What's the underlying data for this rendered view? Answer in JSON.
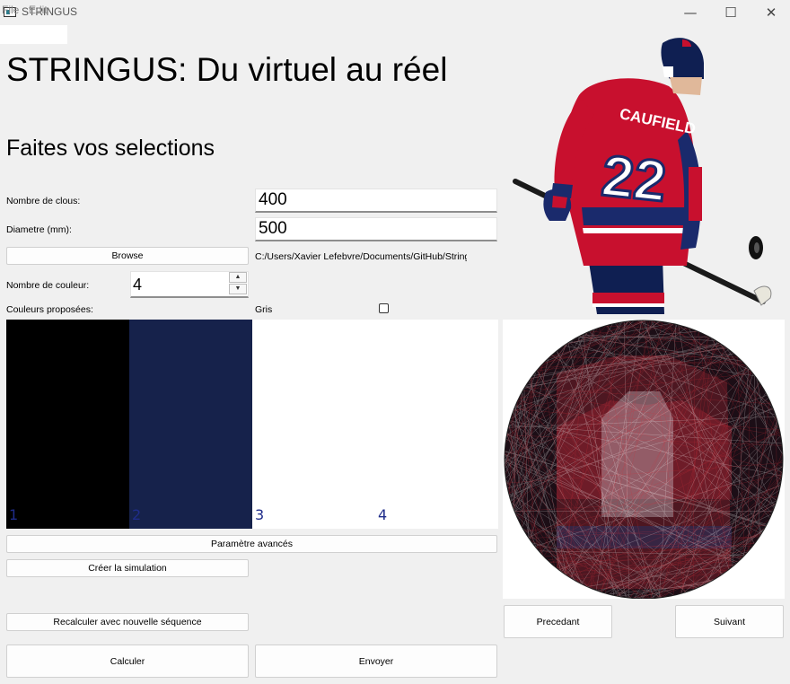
{
  "window": {
    "title": "STRINGUS",
    "minimize": "—",
    "maximize": "☐",
    "close": "✕"
  },
  "menu": {
    "file": "File",
    "edit": "Edit"
  },
  "main_title": "STRINGUS: Du virtuel au réel",
  "subtitle": "Faites vos selections",
  "form": {
    "nails_label": "Nombre de clous:",
    "nails_value": "400",
    "diameter_label": "Diametre (mm):",
    "diameter_value": "500",
    "browse_label": "Browse",
    "browse_path": "C:/Users/Xavier Lefebvre/Documents/GitHub/StringU",
    "colors_count_label": "Nombre de couleur:",
    "colors_count_value": "4",
    "proposed_colors_label": "Couleurs proposées:",
    "gris_label": "Gris"
  },
  "swatches": [
    {
      "number": "1",
      "color": "#000000"
    },
    {
      "number": "2",
      "color": "#9b1214"
    },
    {
      "number": "3",
      "color": "#16224b"
    },
    {
      "number": "4",
      "color": "#ffffff"
    }
  ],
  "buttons": {
    "advanced": "Paramètre avancés",
    "create_sim": "Créer la simulation",
    "recalc": "Recalculer avec nouvelle séquence",
    "calculate": "Calculer",
    "send": "Envoyer",
    "previous": "Precedant",
    "next": "Suivant"
  },
  "player_jersey": {
    "name": "CAUFIELD",
    "number": "22"
  },
  "colors": {
    "jersey_red": "#c8102e",
    "jersey_blue": "#1a2a6c"
  }
}
